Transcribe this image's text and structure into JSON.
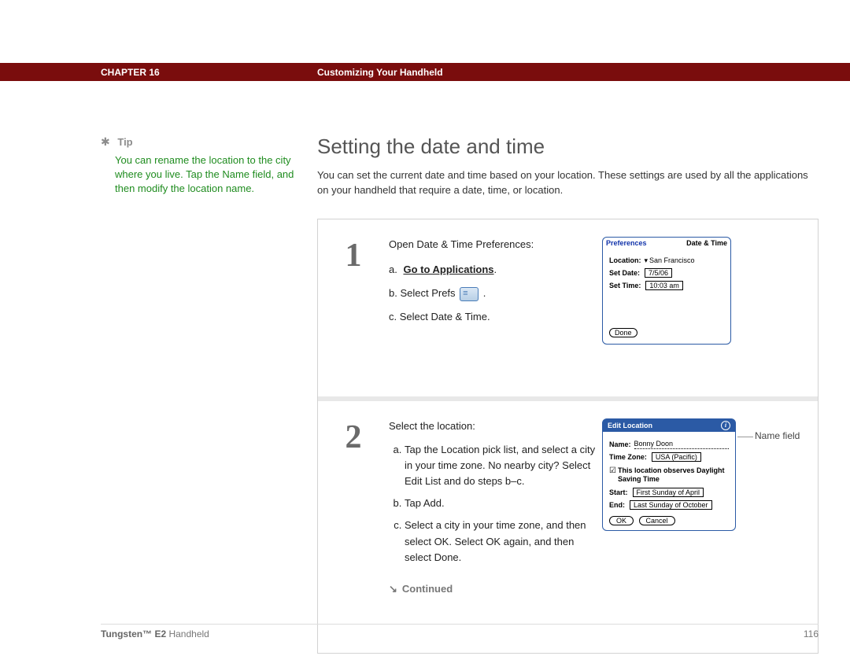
{
  "header": {
    "chapter": "CHAPTER 16",
    "title": "Customizing Your Handheld"
  },
  "sidebar": {
    "tip_label": "Tip",
    "tip_body": "You can rename the location to the city where you live. Tap the Name field, and then modify the location name."
  },
  "main": {
    "heading": "Setting the date and time",
    "intro": "You can set the current date and time based on your location. These settings are used by all the applications on your handheld that require a date, time, or location."
  },
  "steps": [
    {
      "num": "1",
      "lead": "Open Date & Time Preferences:",
      "a_prefix": "a.",
      "a_link": "Go to Applications",
      "a_suffix": ".",
      "b_prefix": "b.  Select Prefs",
      "b_suffix": ".",
      "c": "c.  Select Date & Time.",
      "palm": {
        "title_left": "Preferences",
        "title_right": "Date & Time",
        "loc_label": "Location:",
        "loc_value": "San Francisco",
        "date_label": "Set Date:",
        "date_value": "7/5/06",
        "time_label": "Set Time:",
        "time_value": "10:03 am",
        "done": "Done"
      }
    },
    {
      "num": "2",
      "lead": "Select the location:",
      "a": "Tap the Location pick list, and select a city in your time zone. No nearby city? Select Edit List and do steps b–c.",
      "b": "Tap Add.",
      "c": "Select a city in your time zone, and then select OK. Select OK again, and then select Done.",
      "continued": "Continued",
      "callout": "Name field",
      "palm": {
        "title": "Edit Location",
        "name_label": "Name:",
        "name_value": "Bonny Doon",
        "tz_label": "Time Zone:",
        "tz_value": "USA (Pacific)",
        "dst": "This location observes Daylight Saving Time",
        "start_label": "Start:",
        "start_value": "First Sunday of April",
        "end_label": "End:",
        "end_value": "Last Sunday of October",
        "ok": "OK",
        "cancel": "Cancel"
      }
    }
  ],
  "footer": {
    "product_bold": "Tungsten™ E2",
    "product_rest": " Handheld",
    "page": "116"
  }
}
